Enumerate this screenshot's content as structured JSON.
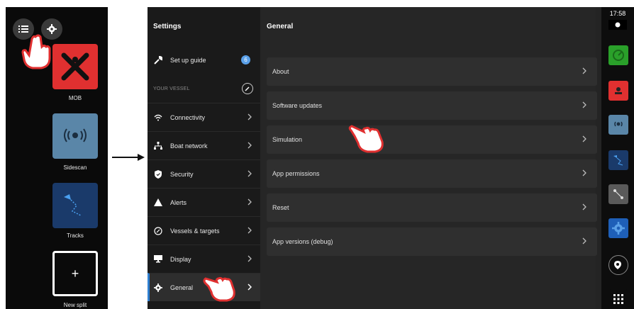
{
  "home": {
    "tiles": [
      {
        "label": "MOB",
        "color": "#e03030",
        "icon": "mob-cross-icon"
      },
      {
        "label": "Sidescan",
        "color": "#5a86a8",
        "icon": "sidescan-icon"
      },
      {
        "label": "Tracks",
        "color": "#1a3a6a",
        "icon": "tracks-icon"
      },
      {
        "label": "New split",
        "color": "#0a0a0a",
        "icon": "plus-icon"
      }
    ],
    "top_buttons": [
      "list-icon",
      "gear-icon"
    ],
    "new_split_symbol": "+"
  },
  "settings": {
    "title": "Settings",
    "setup_guide": {
      "label": "Set up guide",
      "badge": "6"
    },
    "section_header": "YOUR VESSEL",
    "items": [
      {
        "label": "Connectivity",
        "icon": "wifi-icon"
      },
      {
        "label": "Boat network",
        "icon": "network-icon"
      },
      {
        "label": "Security",
        "icon": "shield-icon"
      },
      {
        "label": "Alerts",
        "icon": "warning-icon"
      },
      {
        "label": "Vessels & targets",
        "icon": "target-icon"
      },
      {
        "label": "Display",
        "icon": "display-icon"
      },
      {
        "label": "General",
        "icon": "gear-icon",
        "active": true
      }
    ]
  },
  "general": {
    "title": "General",
    "rows": [
      "About",
      "Software updates",
      "Simulation",
      "App permissions",
      "Reset",
      "App versions (debug)"
    ]
  },
  "rail": {
    "clock": "17:58",
    "buttons": [
      {
        "name": "radar-app-button",
        "color": "#2aa02a"
      },
      {
        "name": "mob-app-button",
        "color": "#e03030"
      },
      {
        "name": "sidescan-app-button",
        "color": "#5a86a8"
      },
      {
        "name": "tracks-app-button",
        "color": "#1a3a6a"
      },
      {
        "name": "routes-app-button",
        "color": "#5a5a5a"
      },
      {
        "name": "settings-app-button",
        "color": "#1e5fb8"
      }
    ]
  },
  "colors": {
    "accent": "#2f7fd0",
    "hand_red": "#e03030"
  }
}
